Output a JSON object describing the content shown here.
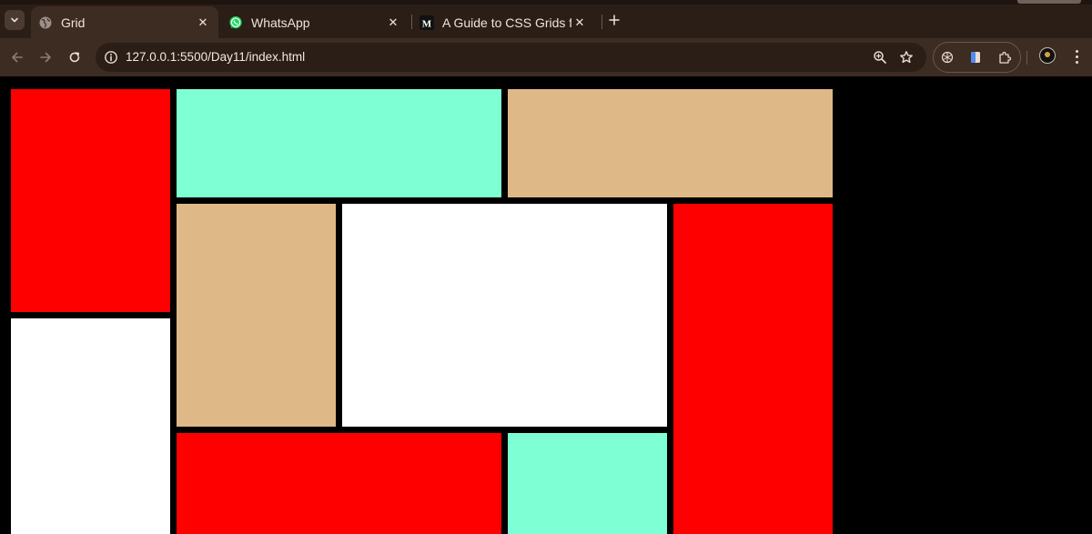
{
  "browser": {
    "tabs": [
      {
        "title": "Grid",
        "active": true,
        "favicon": "globe-icon"
      },
      {
        "title": "WhatsApp",
        "active": false,
        "favicon": "whatsapp-icon"
      },
      {
        "title": "A Guide to CSS Grids for",
        "active": false,
        "favicon": "medium-icon",
        "favicon_text": "M"
      }
    ],
    "url": "127.0.0.1:5500/Day11/index.html"
  },
  "colors": {
    "red": "#ff0000",
    "aquamarine": "#7fffd4",
    "burlywood": "#deb887",
    "white": "#ffffff",
    "page_background": "#000000"
  },
  "grid_items": [
    {
      "name": "grid-item-1",
      "color": "#ff0000"
    },
    {
      "name": "grid-item-2",
      "color": "#7fffd4"
    },
    {
      "name": "grid-item-3",
      "color": "#deb887"
    },
    {
      "name": "grid-item-4",
      "color": "#deb887"
    },
    {
      "name": "grid-item-5",
      "color": "#ffffff"
    },
    {
      "name": "grid-item-6",
      "color": "#ff0000"
    },
    {
      "name": "grid-item-7",
      "color": "#ffffff"
    },
    {
      "name": "grid-item-8",
      "color": "#ff0000"
    },
    {
      "name": "grid-item-9",
      "color": "#7fffd4"
    }
  ]
}
